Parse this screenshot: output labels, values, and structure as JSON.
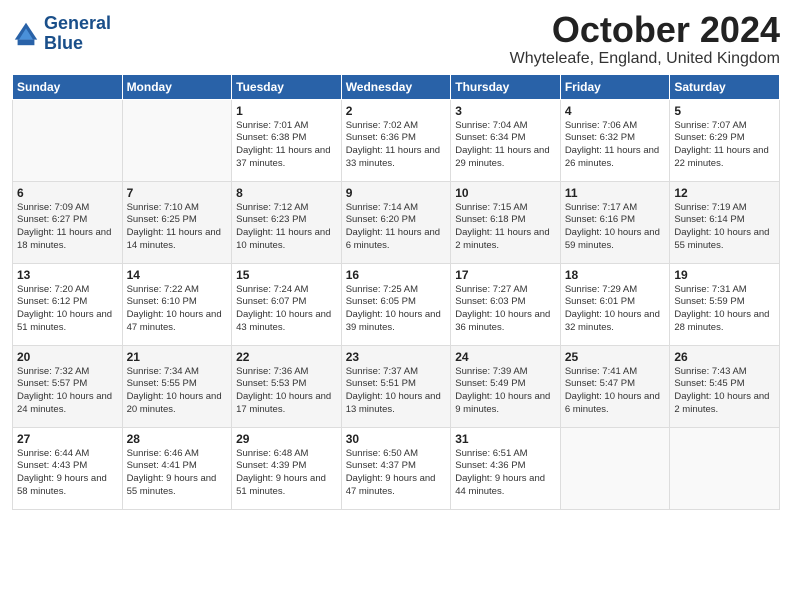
{
  "logo": {
    "line1": "General",
    "line2": "Blue"
  },
  "title": "October 2024",
  "location": "Whyteleafe, England, United Kingdom",
  "days_of_week": [
    "Sunday",
    "Monday",
    "Tuesday",
    "Wednesday",
    "Thursday",
    "Friday",
    "Saturday"
  ],
  "weeks": [
    [
      {
        "day": "",
        "info": ""
      },
      {
        "day": "",
        "info": ""
      },
      {
        "day": "1",
        "info": "Sunrise: 7:01 AM\nSunset: 6:38 PM\nDaylight: 11 hours\nand 37 minutes."
      },
      {
        "day": "2",
        "info": "Sunrise: 7:02 AM\nSunset: 6:36 PM\nDaylight: 11 hours\nand 33 minutes."
      },
      {
        "day": "3",
        "info": "Sunrise: 7:04 AM\nSunset: 6:34 PM\nDaylight: 11 hours\nand 29 minutes."
      },
      {
        "day": "4",
        "info": "Sunrise: 7:06 AM\nSunset: 6:32 PM\nDaylight: 11 hours\nand 26 minutes."
      },
      {
        "day": "5",
        "info": "Sunrise: 7:07 AM\nSunset: 6:29 PM\nDaylight: 11 hours\nand 22 minutes."
      }
    ],
    [
      {
        "day": "6",
        "info": "Sunrise: 7:09 AM\nSunset: 6:27 PM\nDaylight: 11 hours\nand 18 minutes."
      },
      {
        "day": "7",
        "info": "Sunrise: 7:10 AM\nSunset: 6:25 PM\nDaylight: 11 hours\nand 14 minutes."
      },
      {
        "day": "8",
        "info": "Sunrise: 7:12 AM\nSunset: 6:23 PM\nDaylight: 11 hours\nand 10 minutes."
      },
      {
        "day": "9",
        "info": "Sunrise: 7:14 AM\nSunset: 6:20 PM\nDaylight: 11 hours\nand 6 minutes."
      },
      {
        "day": "10",
        "info": "Sunrise: 7:15 AM\nSunset: 6:18 PM\nDaylight: 11 hours\nand 2 minutes."
      },
      {
        "day": "11",
        "info": "Sunrise: 7:17 AM\nSunset: 6:16 PM\nDaylight: 10 hours\nand 59 minutes."
      },
      {
        "day": "12",
        "info": "Sunrise: 7:19 AM\nSunset: 6:14 PM\nDaylight: 10 hours\nand 55 minutes."
      }
    ],
    [
      {
        "day": "13",
        "info": "Sunrise: 7:20 AM\nSunset: 6:12 PM\nDaylight: 10 hours\nand 51 minutes."
      },
      {
        "day": "14",
        "info": "Sunrise: 7:22 AM\nSunset: 6:10 PM\nDaylight: 10 hours\nand 47 minutes."
      },
      {
        "day": "15",
        "info": "Sunrise: 7:24 AM\nSunset: 6:07 PM\nDaylight: 10 hours\nand 43 minutes."
      },
      {
        "day": "16",
        "info": "Sunrise: 7:25 AM\nSunset: 6:05 PM\nDaylight: 10 hours\nand 39 minutes."
      },
      {
        "day": "17",
        "info": "Sunrise: 7:27 AM\nSunset: 6:03 PM\nDaylight: 10 hours\nand 36 minutes."
      },
      {
        "day": "18",
        "info": "Sunrise: 7:29 AM\nSunset: 6:01 PM\nDaylight: 10 hours\nand 32 minutes."
      },
      {
        "day": "19",
        "info": "Sunrise: 7:31 AM\nSunset: 5:59 PM\nDaylight: 10 hours\nand 28 minutes."
      }
    ],
    [
      {
        "day": "20",
        "info": "Sunrise: 7:32 AM\nSunset: 5:57 PM\nDaylight: 10 hours\nand 24 minutes."
      },
      {
        "day": "21",
        "info": "Sunrise: 7:34 AM\nSunset: 5:55 PM\nDaylight: 10 hours\nand 20 minutes."
      },
      {
        "day": "22",
        "info": "Sunrise: 7:36 AM\nSunset: 5:53 PM\nDaylight: 10 hours\nand 17 minutes."
      },
      {
        "day": "23",
        "info": "Sunrise: 7:37 AM\nSunset: 5:51 PM\nDaylight: 10 hours\nand 13 minutes."
      },
      {
        "day": "24",
        "info": "Sunrise: 7:39 AM\nSunset: 5:49 PM\nDaylight: 10 hours\nand 9 minutes."
      },
      {
        "day": "25",
        "info": "Sunrise: 7:41 AM\nSunset: 5:47 PM\nDaylight: 10 hours\nand 6 minutes."
      },
      {
        "day": "26",
        "info": "Sunrise: 7:43 AM\nSunset: 5:45 PM\nDaylight: 10 hours\nand 2 minutes."
      }
    ],
    [
      {
        "day": "27",
        "info": "Sunrise: 6:44 AM\nSunset: 4:43 PM\nDaylight: 9 hours\nand 58 minutes."
      },
      {
        "day": "28",
        "info": "Sunrise: 6:46 AM\nSunset: 4:41 PM\nDaylight: 9 hours\nand 55 minutes."
      },
      {
        "day": "29",
        "info": "Sunrise: 6:48 AM\nSunset: 4:39 PM\nDaylight: 9 hours\nand 51 minutes."
      },
      {
        "day": "30",
        "info": "Sunrise: 6:50 AM\nSunset: 4:37 PM\nDaylight: 9 hours\nand 47 minutes."
      },
      {
        "day": "31",
        "info": "Sunrise: 6:51 AM\nSunset: 4:36 PM\nDaylight: 9 hours\nand 44 minutes."
      },
      {
        "day": "",
        "info": ""
      },
      {
        "day": "",
        "info": ""
      }
    ]
  ]
}
